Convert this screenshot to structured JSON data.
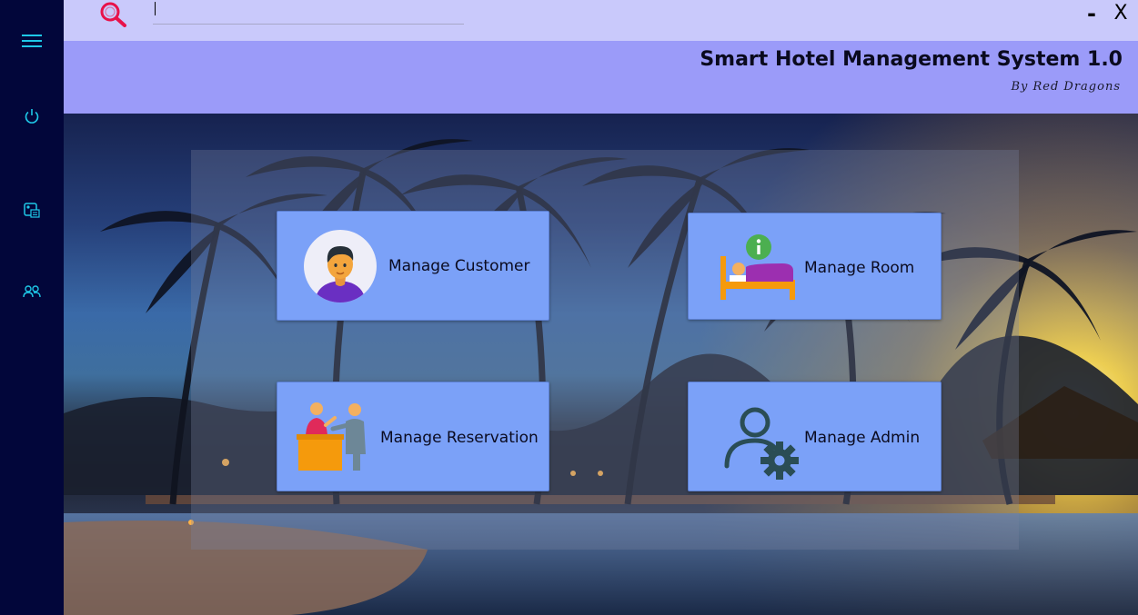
{
  "window": {
    "minimize_label": "-",
    "close_label": "X"
  },
  "search": {
    "value": "",
    "placeholder": ""
  },
  "header": {
    "title": "Smart Hotel Management System 1.0",
    "subtitle": "By Red Dragons"
  },
  "sidebar": {
    "items": [
      {
        "icon": "hamburger-menu-icon"
      },
      {
        "icon": "power-icon"
      },
      {
        "icon": "room-info-icon"
      },
      {
        "icon": "users-icon"
      }
    ]
  },
  "cards": {
    "customer": {
      "label": "Manage Customer",
      "icon": "customer-avatar-icon"
    },
    "room": {
      "label": "Manage Room",
      "icon": "room-bed-icon"
    },
    "reservation": {
      "label": "Manage Reservation",
      "icon": "reception-desk-icon"
    },
    "admin": {
      "label": "Manage Admin",
      "icon": "admin-settings-icon"
    }
  },
  "colors": {
    "sidebar": "#02063a",
    "sidebar_icon": "#1ec8e8",
    "topbar": "#c9c9fb",
    "banner": "#9b9bf9",
    "card": "#7ba1f8",
    "search_icon": "#e8124a"
  }
}
